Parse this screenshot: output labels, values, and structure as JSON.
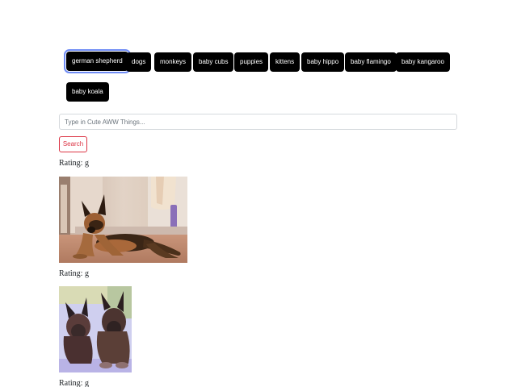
{
  "topics": [
    {
      "label": "german shepherd",
      "focused": true
    },
    {
      "label": "dogs"
    },
    {
      "label": "monkeys"
    },
    {
      "label": "baby cubs"
    },
    {
      "label": "puppies"
    },
    {
      "label": "kittens"
    },
    {
      "label": "baby hippo"
    },
    {
      "label": "baby flamingo"
    },
    {
      "label": "baby kangaroo"
    },
    {
      "label": "baby koala"
    }
  ],
  "search": {
    "placeholder": "Type in Cute AWW Things...",
    "button_label": "Search"
  },
  "results": [
    {
      "rating_label": "Rating: g"
    },
    {
      "rating_label": "Rating: g"
    },
    {
      "rating_label": "Rating: g"
    }
  ],
  "colors": {
    "button_bg": "#000000",
    "search_button_accent": "#dc3545",
    "focus_ring": "#6f8cf5"
  }
}
